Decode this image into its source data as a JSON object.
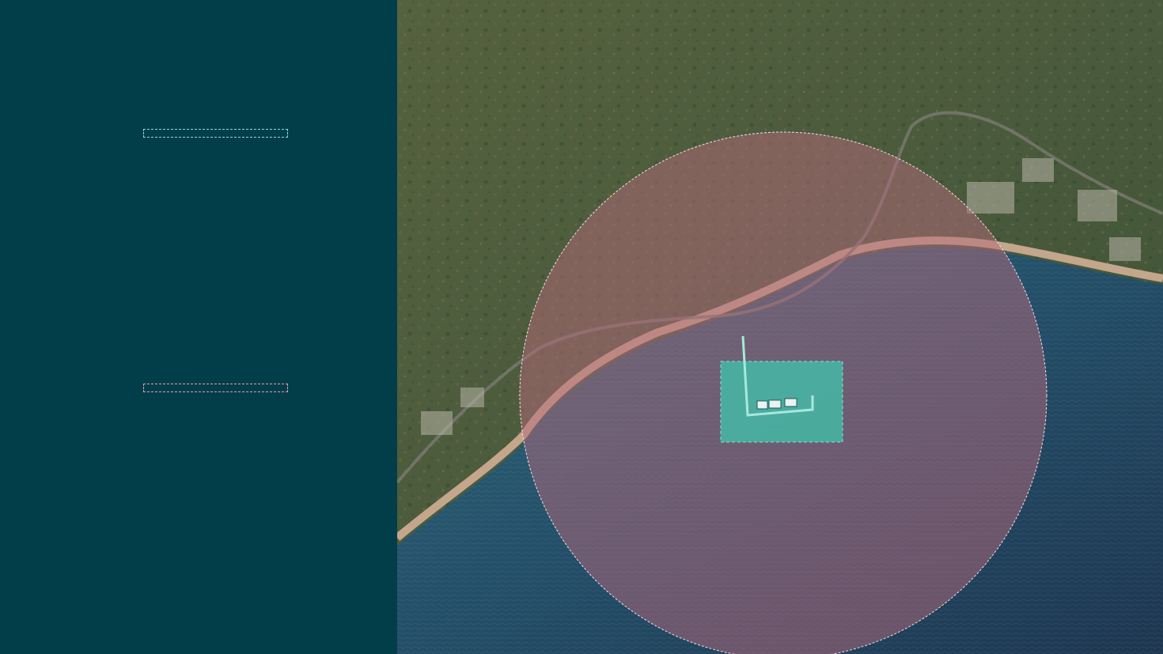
{
  "legend": {
    "items": [
      {
        "color": "#7fe3d4"
      },
      {
        "color": "#e59aa6"
      }
    ]
  },
  "map": {
    "colors": {
      "land": "#4a5a3c",
      "sea_deep": "#1e3650",
      "sea_shallow": "#2e6b78",
      "beach": "#d9b49a",
      "road": "#7a7a72",
      "buffer_zone_fill": "#b56a7c",
      "buffer_zone_stroke": "#f4dde2",
      "site_fill": "#3fc6ac",
      "site_stroke": "#7fe3d4"
    }
  }
}
